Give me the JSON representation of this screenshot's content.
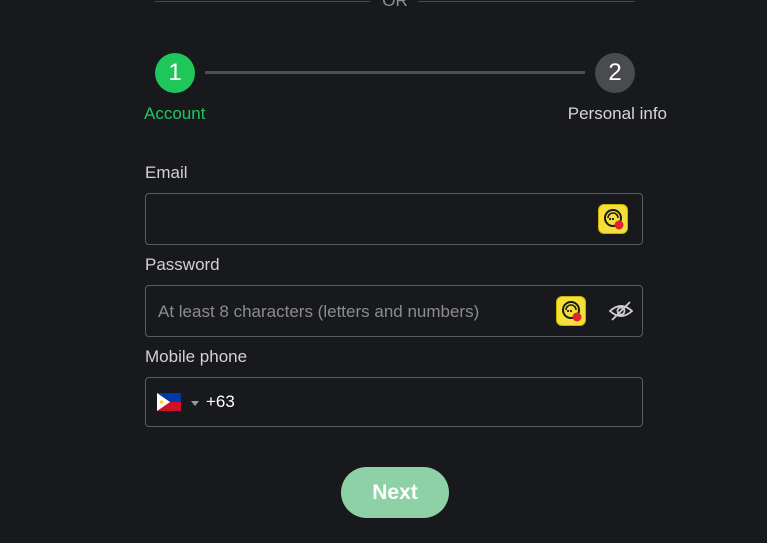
{
  "divider": {
    "text": "OR"
  },
  "stepper": {
    "steps": [
      {
        "number": "1",
        "label": "Account",
        "state": "active"
      },
      {
        "number": "2",
        "label": "Personal info",
        "state": "inactive"
      }
    ]
  },
  "form": {
    "email": {
      "label": "Email",
      "value": "",
      "placeholder": ""
    },
    "password": {
      "label": "Password",
      "value": "",
      "placeholder": "At least 8 characters (letters and numbers)"
    },
    "mobile": {
      "label": "Mobile phone",
      "country_flag": "philippines-flag",
      "dial_code": "+63"
    }
  },
  "actions": {
    "next_label": "Next"
  },
  "colors": {
    "background": "#18191d",
    "accent_green": "#1fc75a",
    "button_green": "#8fd1a6",
    "inactive_step": "#4a4b4f",
    "extension_icon": "#f5e03a"
  },
  "icons": [
    "password-manager-icon",
    "eye-off-icon",
    "chevron-down-icon"
  ]
}
